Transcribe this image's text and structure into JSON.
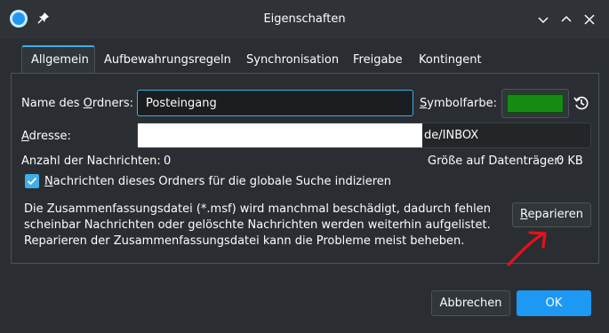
{
  "window": {
    "title": "Eigenschaften",
    "icons": [
      "app-icon",
      "pin-icon",
      "chevron-down-icon",
      "chevron-up-icon",
      "close-icon"
    ]
  },
  "tabs": [
    {
      "label": "Allgemein",
      "active": true
    },
    {
      "label": "Aufbewahrungsregeln",
      "active": false
    },
    {
      "label": "Synchronisation",
      "active": false
    },
    {
      "label": "Freigabe",
      "active": false
    },
    {
      "label": "Kontingent",
      "active": false
    }
  ],
  "general": {
    "folder_name_label_pre": "Name des ",
    "folder_name_label_ul": "O",
    "folder_name_label_post": "rdners:",
    "folder_name_value": "Posteingang",
    "symbol_color_label_ul": "S",
    "symbol_color_label_post": "ymbolfarbe:",
    "symbol_color": "#148c14",
    "address_label_ul": "A",
    "address_label_post": "dresse:",
    "address_value_visible": "de/INBOX",
    "message_count_label": "Anzahl der Nachrichten:",
    "message_count_value": "0",
    "disk_size_label": "Größe auf Datenträger:",
    "disk_size_value": "0 KB",
    "index_checkbox_label_ul": "N",
    "index_checkbox_label_post": "achrichten dieses Ordners für die globale Suche indizieren",
    "index_checked": true,
    "repair_text_line1": "Die Zusammenfassungsdatei (*.msf) wird manchmal beschädigt, dadurch fehlen",
    "repair_text_line2": "scheinbar Nachrichten oder gelöschte Nachrichten werden weiterhin aufgelistet.",
    "repair_text_line3": "Reparieren der Zusammenfassungsdatei kann die Probleme meist beheben.",
    "repair_button_ul": "R",
    "repair_button_post": "eparieren"
  },
  "footer": {
    "cancel_label": "Abbrechen",
    "ok_label": "OK"
  },
  "colors": {
    "accent": "#3daee9",
    "primary_button": "#1d99f3",
    "annotation_arrow": "#e8101a"
  }
}
